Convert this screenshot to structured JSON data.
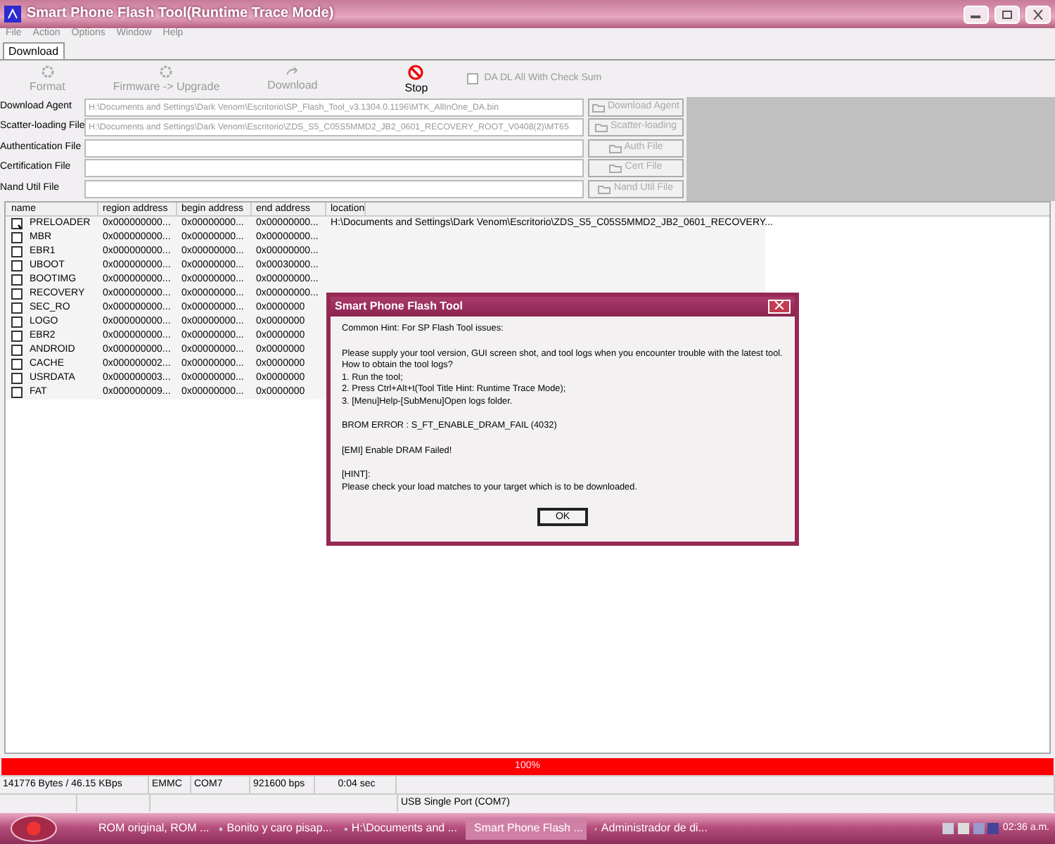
{
  "window": {
    "title": "Smart Phone Flash Tool(Runtime Trace Mode)"
  },
  "menu": [
    "File",
    "Action",
    "Options",
    "Window",
    "Help"
  ],
  "tabs": [
    {
      "label": "Download",
      "selected": true
    }
  ],
  "toolbar": [
    {
      "label": "Format",
      "disabled": true,
      "kind": "gear"
    },
    {
      "label": "Firmware -> Upgrade",
      "disabled": true,
      "kind": "gear"
    },
    {
      "label": "Download",
      "disabled": true,
      "kind": "arrow"
    },
    {
      "label": "Stop",
      "disabled": false,
      "kind": "stop"
    }
  ],
  "checksum": {
    "label": "DA DL All With Check Sum",
    "checked": false
  },
  "files": [
    {
      "label": "Download Agent",
      "value": "H:\\Documents and Settings\\Dark Venom\\Escritorio\\SP_Flash_Tool_v3.1304.0.1196\\MTK_AllInOne_DA.bin",
      "button": "Download Agent"
    },
    {
      "label": "Scatter-loading File",
      "value": "H:\\Documents and Settings\\Dark Venom\\Escritorio\\ZDS_S5_C05S5MMD2_JB2_0601_RECOVERY_ROOT_V0408(2)\\MT65",
      "button": "Scatter-loading"
    },
    {
      "label": "Authentication File",
      "button": "Auth File"
    },
    {
      "label": "Certification File",
      "button": "Cert File"
    },
    {
      "label": "Nand Util File",
      "button": "Nand Util File"
    }
  ],
  "table": {
    "columns": [
      "name",
      "region address",
      "begin address",
      "end address",
      "location"
    ],
    "rows": [
      {
        "checked": true,
        "cells": [
          "PRELOADER",
          "0x000000000...",
          "0x00000000...",
          "0x00000000...",
          "H:\\Documents and Settings\\Dark Venom\\Escritorio\\ZDS_S5_C05S5MMD2_JB2_0601_RECOVERY..."
        ]
      },
      {
        "checked": false,
        "cells": [
          "MBR",
          "0x000000000...",
          "0x00000000...",
          "0x00000000..."
        ]
      },
      {
        "checked": false,
        "cells": [
          "EBR1",
          "0x000000000...",
          "0x00000000...",
          "0x00000000..."
        ]
      },
      {
        "checked": false,
        "cells": [
          "UBOOT",
          "0x000000000...",
          "0x00000000...",
          "0x00030000..."
        ]
      },
      {
        "checked": false,
        "cells": [
          "BOOTIMG",
          "0x000000000...",
          "0x00000000...",
          "0x00000000..."
        ]
      },
      {
        "checked": false,
        "cells": [
          "RECOVERY",
          "0x000000000...",
          "0x00000000...",
          "0x00000000..."
        ]
      },
      {
        "checked": false,
        "cells": [
          "SEC_RO",
          "0x000000000...",
          "0x00000000...",
          "0x0000000"
        ]
      },
      {
        "checked": false,
        "cells": [
          "LOGO",
          "0x000000000...",
          "0x00000000...",
          "0x0000000"
        ]
      },
      {
        "checked": false,
        "cells": [
          "EBR2",
          "0x000000000...",
          "0x00000000...",
          "0x0000000"
        ]
      },
      {
        "checked": false,
        "cells": [
          "ANDROID",
          "0x000000000...",
          "0x00000000...",
          "0x0000000"
        ]
      },
      {
        "checked": false,
        "cells": [
          "CACHE",
          "0x000000002...",
          "0x00000000...",
          "0x0000000"
        ]
      },
      {
        "checked": false,
        "cells": [
          "USRDATA",
          "0x000000003...",
          "0x00000000...",
          "0x0000000"
        ]
      },
      {
        "checked": false,
        "cells": [
          "FAT",
          "0x000000009...",
          "0x00000000...",
          "0x0000000"
        ]
      }
    ]
  },
  "dialog": {
    "title": "Smart Phone Flash Tool",
    "paragraphs": [
      [
        "Common Hint: For SP Flash Tool issues:"
      ],
      [
        "Please supply your tool version, GUI screen shot, and tool logs when you encounter trouble with the latest tool.",
        "How to obtain the tool logs?",
        "1. Run the tool;",
        "2. Press Ctrl+Alt+t(Tool Title Hint: Runtime Trace Mode);",
        "3. [Menu]Help-[SubMenu]Open logs folder."
      ],
      [
        "BROM ERROR : S_FT_ENABLE_DRAM_FAIL (4032)"
      ],
      [
        "[EMI] Enable DRAM Failed!"
      ],
      [
        "[HINT]:",
        "Please check your load matches to your target which is to be downloaded."
      ]
    ],
    "ok": "OK"
  },
  "progress": {
    "level": 1,
    "label": "100%"
  },
  "status": {
    "row1": [
      "141776 Bytes / 46.15 KBps",
      "EMMC",
      "COM7",
      "921600 bps",
      "0:04 sec"
    ],
    "port": "USB Single Port (COM7)"
  },
  "taskbar": {
    "items": [
      {
        "label": "ROM original, ROM ...",
        "selected": false
      },
      {
        "label": "Bonito y caro pisap...",
        "selected": false
      },
      {
        "label": "H:\\Documents and ...",
        "selected": false
      },
      {
        "label": "Smart Phone Flash ...",
        "selected": true
      },
      {
        "label": "Administrador de di...",
        "selected": false
      }
    ],
    "clock": "02:36 a.m."
  }
}
